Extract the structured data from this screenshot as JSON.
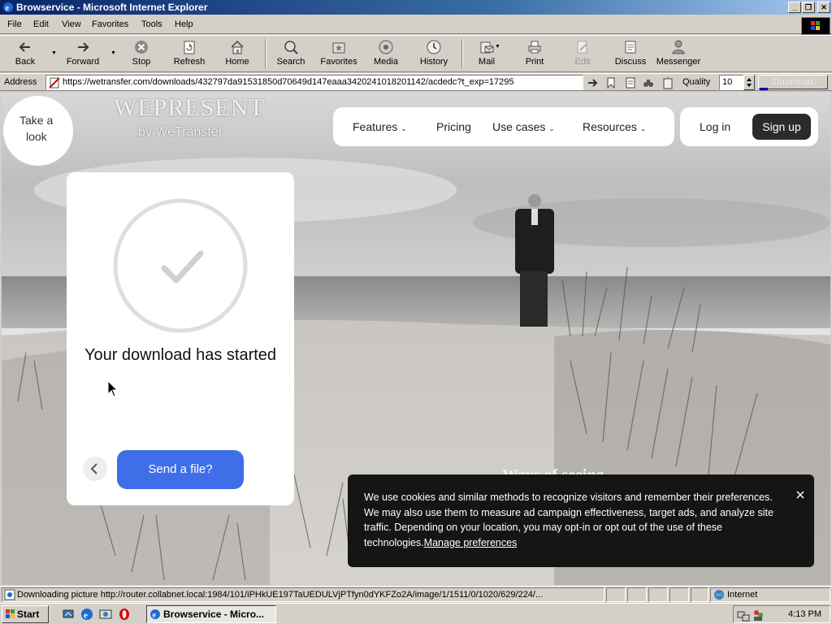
{
  "window": {
    "title": "Browservice - Microsoft Internet Explorer"
  },
  "menu": [
    "File",
    "Edit",
    "View",
    "Favorites",
    "Tools",
    "Help"
  ],
  "toolbar": {
    "back": "Back",
    "forward": "Forward",
    "stop": "Stop",
    "refresh": "Refresh",
    "home": "Home",
    "search": "Search",
    "favorites": "Favorites",
    "media": "Media",
    "history": "History",
    "mail": "Mail",
    "print": "Print",
    "edit": "Edit",
    "discuss": "Discuss",
    "messenger": "Messenger"
  },
  "address": {
    "label": "Address",
    "url": "https://wetransfer.com/downloads/432797da91531850d70649d147eaaa3420241018201142/acdedc?t_exp=17295",
    "quality_label": "Quality",
    "quality_value": "10",
    "download_label": "Download"
  },
  "page": {
    "logo_line1": "Take a",
    "logo_line2": "look",
    "brand": "WEPRESENT",
    "brand_sub": "by WeTransfer",
    "nav": [
      "Features",
      "Pricing",
      "Use cases",
      "Resources"
    ],
    "login": "Log in",
    "signup": "Sign up",
    "card_title": "Your download has started",
    "send_button": "Send a file?",
    "ways_text": "Ways of seeing",
    "cookie_text": "We use cookies and similar methods to recognize visitors and remember their preferences. We may also use them to measure ad campaign effectiveness, target ads, and analyze site traffic. Depending on your location, you may opt-in or opt out of the use of these technologies.",
    "cookie_link": "Manage preferences"
  },
  "status": {
    "text": "Downloading picture http://router.collabnet.local:1984/101/iPHkUE197TaUEDULVjPTfyn0dYKFZo2A/image/1/1511/0/1020/629/224/...",
    "zone": "Internet"
  },
  "taskbar": {
    "start": "Start",
    "task": "Browservice - Micro...",
    "clock": "4:13 PM"
  }
}
